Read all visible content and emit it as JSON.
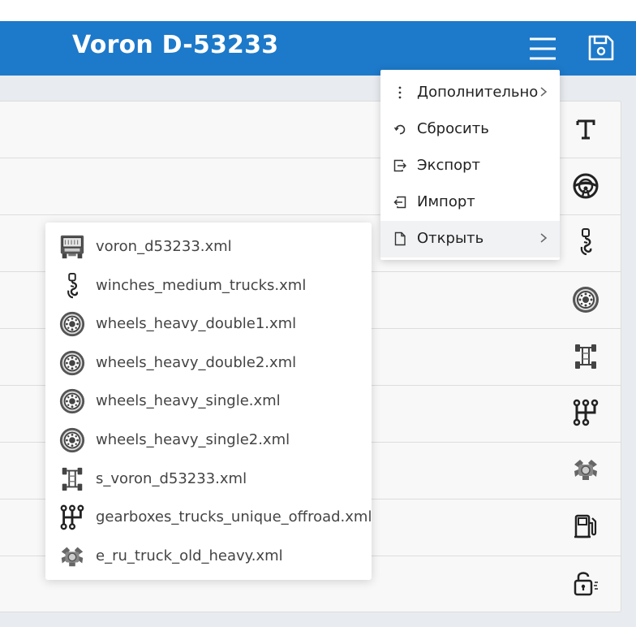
{
  "header": {
    "title": "Voron D-53233",
    "menu_icon": "hamburger-menu-icon",
    "save_icon": "floppy-disk-icon"
  },
  "side_icons": [
    "text-icon",
    "steering-wheel-icon",
    "winch-hook-icon",
    "wheel-icon",
    "chassis-icon",
    "gearbox-icon",
    "engine-icon",
    "fuel-pump-icon",
    "unlock-icon"
  ],
  "menu": {
    "items": [
      {
        "label": "Дополнительно",
        "icon": "vertical-ellipsis-icon",
        "has_submenu": true
      },
      {
        "label": "Сбросить",
        "icon": "reset-icon",
        "has_submenu": false
      },
      {
        "label": "Экспорт",
        "icon": "export-icon",
        "has_submenu": false
      },
      {
        "label": "Импорт",
        "icon": "import-icon",
        "has_submenu": false
      },
      {
        "label": "Открыть",
        "icon": "file-icon",
        "has_submenu": true
      }
    ]
  },
  "files": [
    {
      "name": "voron_d53233.xml",
      "icon": "truck-icon"
    },
    {
      "name": "winches_medium_trucks.xml",
      "icon": "winch-hook-icon"
    },
    {
      "name": "wheels_heavy_double1.xml",
      "icon": "wheel-icon"
    },
    {
      "name": "wheels_heavy_double2.xml",
      "icon": "wheel-icon"
    },
    {
      "name": "wheels_heavy_single.xml",
      "icon": "wheel-icon"
    },
    {
      "name": "wheels_heavy_single2.xml",
      "icon": "wheel-icon"
    },
    {
      "name": "s_voron_d53233.xml",
      "icon": "chassis-icon"
    },
    {
      "name": "gearboxes_trucks_unique_offroad.xml",
      "icon": "gearbox-icon"
    },
    {
      "name": "e_ru_truck_old_heavy.xml",
      "icon": "engine-icon"
    }
  ],
  "colors": {
    "header_bg": "#1d79c9",
    "page_bg": "#e8ebef",
    "panel_bg": "#f8f8f8",
    "menu_active_bg": "#f1f2f4"
  }
}
